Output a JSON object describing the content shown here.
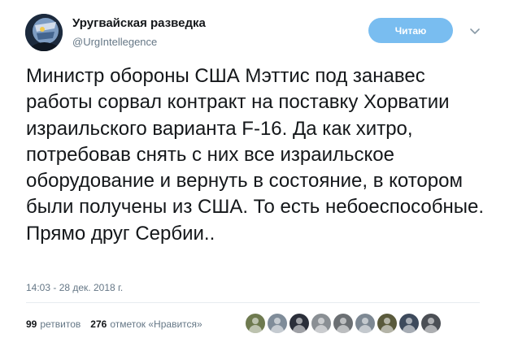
{
  "header": {
    "display_name": "Уругвайская разведка",
    "handle": "@UrgIntellegence",
    "follow_label": "Читаю"
  },
  "tweet": {
    "text": "Министр обороны США Мэттис под занавес работы сорвал контракт на поставку Хорватии израильского варианта F-16. Да как хитро, потребовав снять с них все израильское оборудование и вернуть в состояние, в котором были получены из США. То есть небоеспособные. Прямо друг Сербии..",
    "timestamp": "14:03 - 28 дек. 2018 г."
  },
  "stats": {
    "retweets_count": "99",
    "retweets_label": "ретвитов",
    "likes_count": "276",
    "likes_label": "отметок «Нравится»"
  },
  "likers": [
    {
      "color": "#6e7a4f",
      "icon": "avatar"
    },
    {
      "color": "#7f8c99",
      "icon": "avatar"
    },
    {
      "color": "#2b2f3a",
      "icon": "avatar"
    },
    {
      "color": "#8a8f94",
      "icon": "avatar"
    },
    {
      "color": "#6b6f73",
      "icon": "avatar"
    },
    {
      "color": "#7d8893",
      "icon": "avatar"
    },
    {
      "color": "#5a5a3c",
      "icon": "avatar"
    },
    {
      "color": "#3d4a5c",
      "icon": "avatar"
    },
    {
      "color": "#4b4f55",
      "icon": "avatar"
    }
  ],
  "colors": {
    "follow_button": "#79bdf0",
    "secondary_text": "#657786",
    "primary_text": "#14171a"
  }
}
